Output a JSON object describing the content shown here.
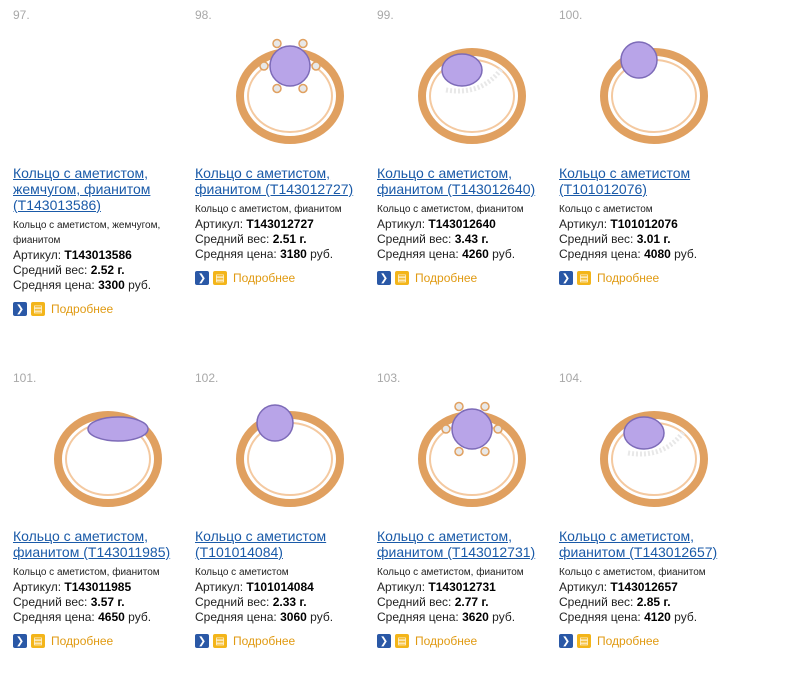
{
  "products": [
    {
      "num": "97.",
      "title": "Кольцо с аметистом, жемчугом, фианитом (T143013586)",
      "desc": "Кольцо с аметистом, жемчугом, фианитом",
      "sku_label": "Артикул:",
      "sku": "T143013586",
      "weight_label": "Средний вес:",
      "weight": "2.52",
      "weight_unit": "г.",
      "price_label": "Средняя цена:",
      "price": "3300",
      "price_unit": "руб.",
      "more": "Подробнее",
      "has_image": false
    },
    {
      "num": "98.",
      "title": "Кольцо с аметистом, фианитом (T143012727)",
      "desc": "Кольцо с аметистом, фианитом",
      "sku_label": "Артикул:",
      "sku": "T143012727",
      "weight_label": "Средний вес:",
      "weight": "2.51",
      "weight_unit": "г.",
      "price_label": "Средняя цена:",
      "price": "3180",
      "price_unit": "руб.",
      "more": "Подробнее",
      "has_image": true,
      "style": "flower"
    },
    {
      "num": "99.",
      "title": "Кольцо с аметистом, фианитом (T143012640)",
      "desc": "Кольцо с аметистом, фианитом",
      "sku_label": "Артикул:",
      "sku": "T143012640",
      "weight_label": "Средний вес:",
      "weight": "3.43",
      "weight_unit": "г.",
      "price_label": "Средняя цена:",
      "price": "4260",
      "price_unit": "руб.",
      "more": "Подробнее",
      "has_image": true,
      "style": "oval-pave"
    },
    {
      "num": "100.",
      "title": "Кольцо с аметистом (T101012076)",
      "desc": "Кольцо с аметистом",
      "sku_label": "Артикул:",
      "sku": "T101012076",
      "weight_label": "Средний вес:",
      "weight": "3.01",
      "weight_unit": "г.",
      "price_label": "Средняя цена:",
      "price": "4080",
      "price_unit": "руб.",
      "more": "Подробнее",
      "has_image": true,
      "style": "solitaire"
    },
    {
      "num": "101.",
      "title": "Кольцо с аметистом, фианитом (T143011985)",
      "desc": "Кольцо с аметистом, фианитом",
      "sku_label": "Артикул:",
      "sku": "T143011985",
      "weight_label": "Средний вес:",
      "weight": "3.57",
      "weight_unit": "г.",
      "price_label": "Средняя цена:",
      "price": "4650",
      "price_unit": "руб.",
      "more": "Подробнее",
      "has_image": true,
      "style": "marquise"
    },
    {
      "num": "102.",
      "title": "Кольцо с аметистом (T101014084)",
      "desc": "Кольцо с аметистом",
      "sku_label": "Артикул:",
      "sku": "T101014084",
      "weight_label": "Средний вес:",
      "weight": "2.33",
      "weight_unit": "г.",
      "price_label": "Средняя цена:",
      "price": "3060",
      "price_unit": "руб.",
      "more": "Подробнее",
      "has_image": true,
      "style": "solitaire"
    },
    {
      "num": "103.",
      "title": "Кольцо с аметистом, фианитом (T143012731)",
      "desc": "Кольцо с аметистом, фианитом",
      "sku_label": "Артикул:",
      "sku": "T143012731",
      "weight_label": "Средний вес:",
      "weight": "2.77",
      "weight_unit": "г.",
      "price_label": "Средняя цена:",
      "price": "3620",
      "price_unit": "руб.",
      "more": "Подробнее",
      "has_image": true,
      "style": "flower"
    },
    {
      "num": "104.",
      "title": "Кольцо с аметистом, фианитом (T143012657)",
      "desc": "Кольцо с аметистом, фианитом",
      "sku_label": "Артикул:",
      "sku": "T143012657",
      "weight_label": "Средний вес:",
      "weight": "2.85",
      "weight_unit": "г.",
      "price_label": "Средняя цена:",
      "price": "4120",
      "price_unit": "руб.",
      "more": "Подробнее",
      "has_image": true,
      "style": "oval-pave"
    }
  ],
  "colors": {
    "link": "#1a5aa8",
    "gold": "#e0a060",
    "amethyst": "#b8a4e8",
    "muted": "#a8a8a8",
    "more": "#e09a12",
    "go": "#2a58a6",
    "cart": "#f3b51a"
  },
  "icons": {
    "go": "chevron-right-icon",
    "cart": "cart-icon"
  }
}
